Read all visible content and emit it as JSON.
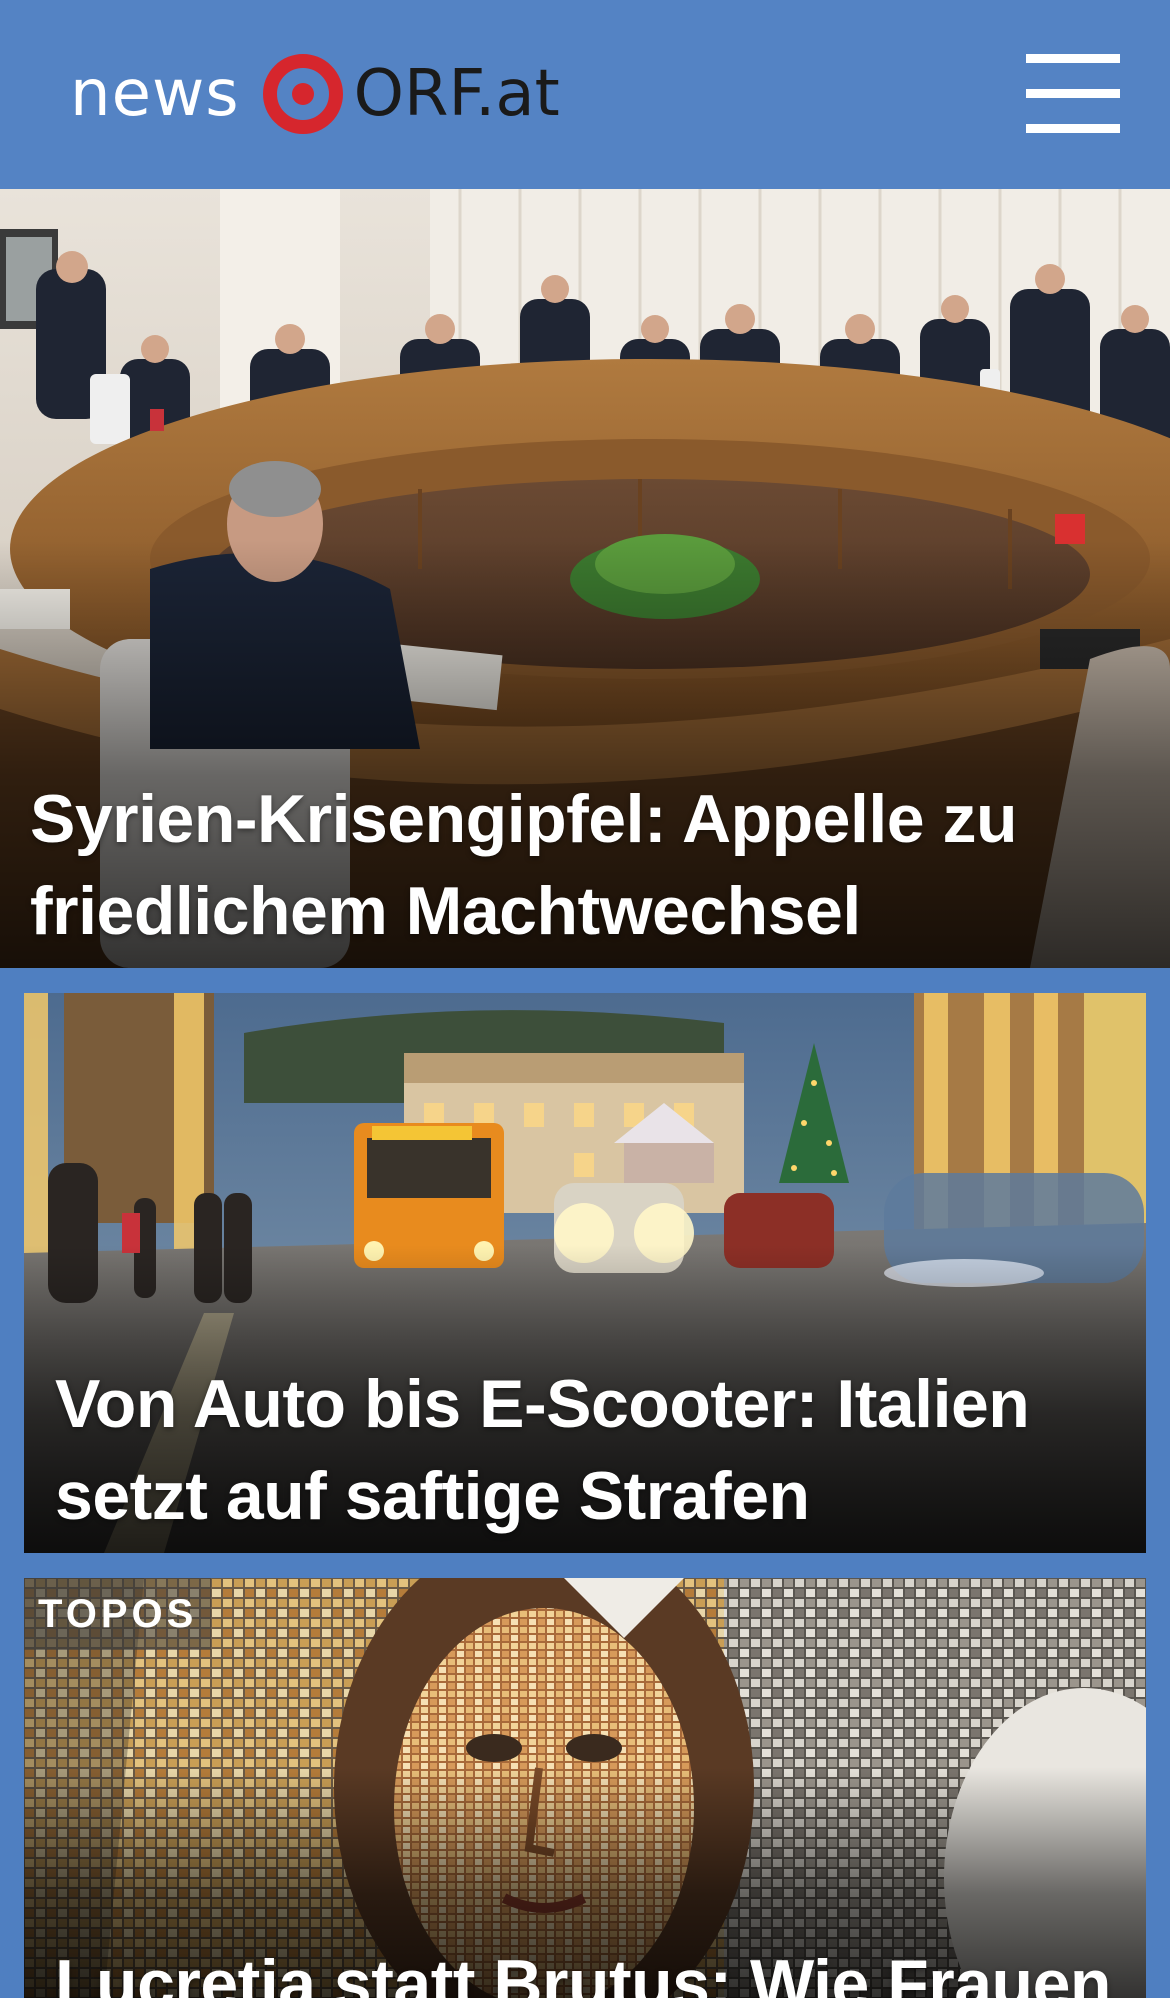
{
  "header": {
    "logo_news": "news",
    "logo_orf": "ORF.at",
    "menu_icon": "hamburger-menu-icon"
  },
  "colors": {
    "header_bg": "#5483c4",
    "page_bg": "#4f7fc1",
    "logo_red": "#d6262d"
  },
  "stories": [
    {
      "headline": "Syrien-Krisengipfel: Appelle zu friedlichem Machtwechsel"
    },
    {
      "headline": "Von Auto bis E-Scooter: Italien setzt auf saftige Strafen"
    },
    {
      "badge": "TOPOS",
      "headline": "Lucretia statt Brutus: Wie Frauen"
    }
  ]
}
